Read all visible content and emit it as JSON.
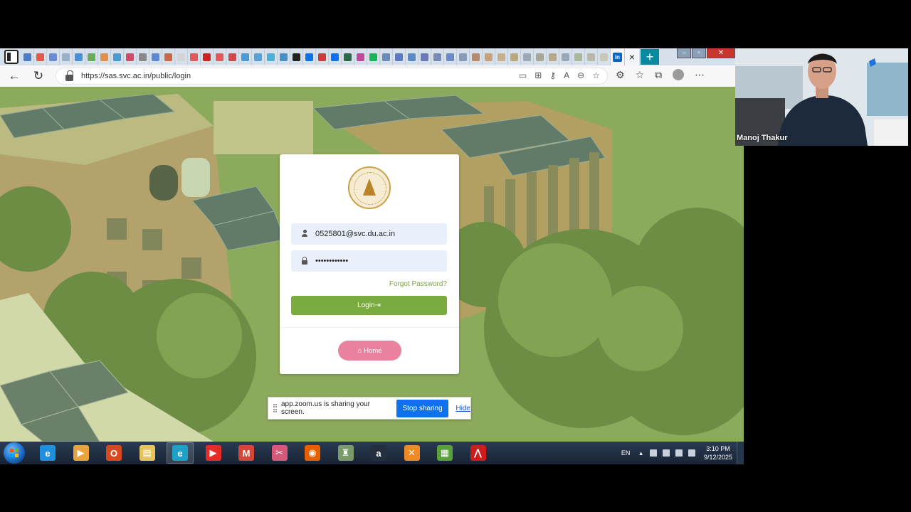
{
  "browser": {
    "url": "https://sas.svc.ac.in/public/login",
    "active_tab_glyph": "in",
    "tab_close_glyph": "×",
    "new_tab_glyph": "+",
    "tab_favicon_colors": [
      "#4a7cc9",
      "#e05a4a",
      "#6b8bd4",
      "#9ab0c8",
      "#4a90d9",
      "#6aaa5a",
      "#e0904a",
      "#4a9ad4",
      "#d04a6a",
      "#888888",
      "#5a8ad4",
      "#c86a4a",
      "#d4d4d4",
      "#e05a5a",
      "#cc2222",
      "#e05a5a",
      "#d04a4a",
      "#4a9ad4",
      "#5aa0d8",
      "#4ab0d8",
      "#4a90c8",
      "#222222",
      "#0e72ed",
      "#d03a3a",
      "#0e72ed",
      "#2a6a4a",
      "#c04a9a",
      "#18b45a",
      "#6a8ab8",
      "#5a7ac8",
      "#5a8ac8",
      "#6a7ab8",
      "#7a8ab8",
      "#6a8ac8",
      "#8a9ab8",
      "#b88a6a",
      "#c8a07a",
      "#c8b08a",
      "#b8a87a",
      "#9aa8b8",
      "#a8a898",
      "#b8a888",
      "#98a8b8",
      "#a8b898",
      "#b8b8a8",
      "#c8c8b8"
    ],
    "window_controls": {
      "minimize": "–",
      "restore": "▫",
      "close": "✕"
    }
  },
  "toolbar_icons": [
    "back-icon",
    "refresh-icon",
    "reading-view-icon",
    "apps-icon",
    "key-icon",
    "read-aloud-icon",
    "zoom-icon",
    "favorite-add-icon",
    "extensions-icon",
    "favorites-icon",
    "collections-icon",
    "profile-icon",
    "more-icon"
  ],
  "login": {
    "email_value": "0525801@svc.du.ac.in",
    "password_value": "••••••••••••",
    "forgot_password": "Forgot Password?",
    "login_label": "Login",
    "login_icon": "⇥",
    "home_label": "Home",
    "home_icon": "⌂"
  },
  "zoom_share": {
    "message": "app.zoom.us is sharing your screen.",
    "stop_label": "Stop sharing",
    "hide_label": "Hide"
  },
  "taskbar": {
    "apps": [
      {
        "name": "internet-explorer-icon",
        "glyph": "e",
        "color": "#1f8fe0"
      },
      {
        "name": "media-player-icon",
        "glyph": "▶",
        "color": "#e8a33a"
      },
      {
        "name": "office-icon",
        "glyph": "O",
        "color": "#d9481e"
      },
      {
        "name": "file-explorer-icon",
        "glyph": "▤",
        "color": "#e6c35c"
      },
      {
        "name": "edge-icon",
        "glyph": "e",
        "color": "#1aa2c9"
      },
      {
        "name": "youtube-icon",
        "glyph": "▶",
        "color": "#e52d27"
      },
      {
        "name": "gmail-icon",
        "glyph": "M",
        "color": "#d44638"
      },
      {
        "name": "snipping-tool-icon",
        "glyph": "✂",
        "color": "#d45a7a"
      },
      {
        "name": "firefox-icon",
        "glyph": "◉",
        "color": "#e66000"
      },
      {
        "name": "app-icon",
        "glyph": "♜",
        "color": "#7a9a6a"
      },
      {
        "name": "amazon-icon",
        "glyph": "a",
        "color": "#232f3e"
      },
      {
        "name": "xampp-icon",
        "glyph": "✕",
        "color": "#f08a24"
      },
      {
        "name": "spreadsheet-icon",
        "glyph": "▦",
        "color": "#5aa03a"
      },
      {
        "name": "acrobat-icon",
        "glyph": "⋀",
        "color": "#d21c1c"
      }
    ],
    "language": "EN",
    "time": "3:10 PM",
    "date": "9/12/2025"
  },
  "video": {
    "participant_name": "Manoj Thakur"
  }
}
